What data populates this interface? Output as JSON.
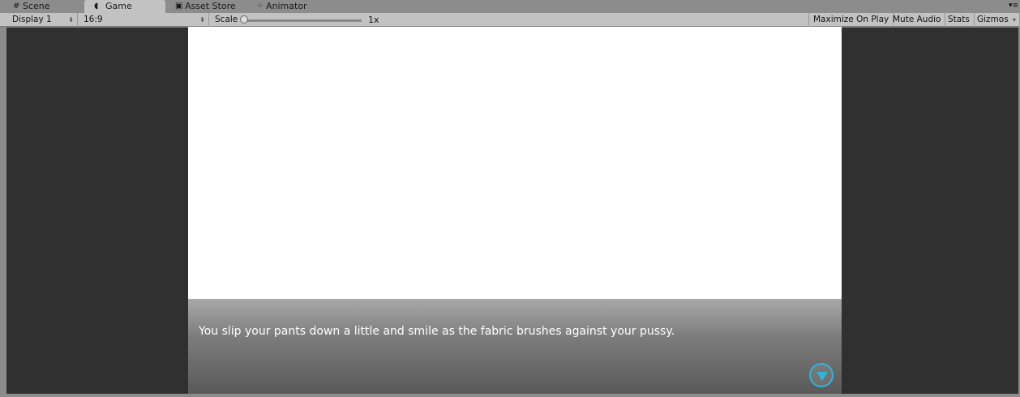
{
  "tabs": [
    {
      "label": "Scene",
      "icon": "grid-icon"
    },
    {
      "label": "Game",
      "icon": "pacman-icon",
      "active": true
    },
    {
      "label": "Asset Store",
      "icon": "bag-icon"
    },
    {
      "label": "Animator",
      "icon": "animator-icon"
    }
  ],
  "toolbar": {
    "display": "Display 1",
    "aspect": "16:9",
    "scale_label": "Scale",
    "scale_value": "1x",
    "maximize": "Maximize On Play",
    "mute": "Mute Audio",
    "stats": "Stats",
    "gizmos": "Gizmos"
  },
  "game": {
    "dialogue": "You slip your pants down a little and smile as the fabric brushes against your pussy.",
    "accent": "#2fb5dc"
  }
}
